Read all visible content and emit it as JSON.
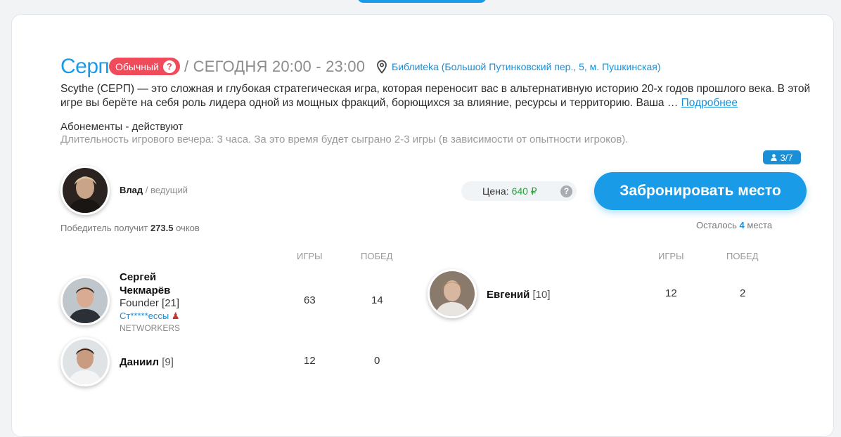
{
  "event": {
    "title": "Серп",
    "type_badge": "Обычный",
    "datetime": "/ СЕГОДНЯ 20:00 - 23:00",
    "location": "Библиtеka (Большой Путинковский пер., 5, м. Пушкинская)",
    "description": "Scythe (СЕРП) — это сложная и глубокая стратегическая игра, которая переносит вас в альтернативную историю 20-х годов прошлого века. В этой игре вы берёте на себя роль лидера одной из мощных фракций, борющихся за влияние, ресурсы и территорию. Ваша …",
    "more_link": "Подробнее",
    "subscriptions": "Абонементы - действуют",
    "duration": "Длительность игрового вечера: 3 часа. За это время будет сыграно 2-3 игры (в зависимости от опытности игроков).",
    "player_count": "3/7"
  },
  "host": {
    "name": "Влад",
    "role": " / ведущий"
  },
  "price": {
    "label": "Цена:",
    "value": "640 ₽"
  },
  "book_button": "Забронировать место",
  "winner": {
    "prefix": "Победитель получит",
    "points": "273.5",
    "suffix": "очков"
  },
  "remaining": {
    "prefix": "Осталось",
    "count": "4",
    "suffix": "места"
  },
  "columns": {
    "games": "ИГРЫ",
    "wins": "ПОБЕД"
  },
  "players": [
    {
      "name_line1": "Сергей",
      "name_line2": "Чекмарёв",
      "role": "Founder [21]",
      "link": "Ст*****ессы",
      "team": "NETWORKERS",
      "games": "63",
      "wins": "14"
    },
    {
      "name": "Даниил",
      "rank": "[9]",
      "games": "12",
      "wins": "0"
    },
    {
      "name": "Евгений",
      "rank": "[10]",
      "games": "12",
      "wins": "2"
    }
  ],
  "colors": {
    "accent": "#1a9be8",
    "badge_red": "#f04b5b",
    "price_green": "#2c9e3e"
  }
}
